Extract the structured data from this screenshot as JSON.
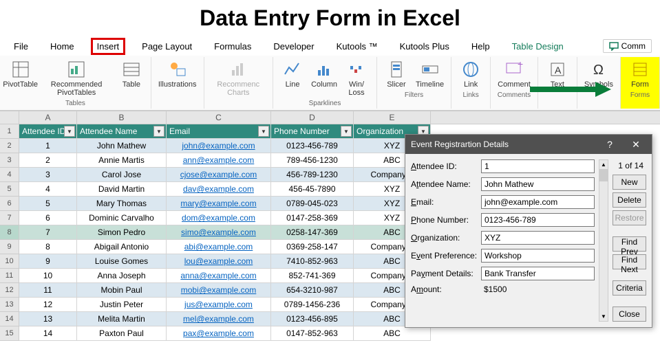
{
  "page_title": "Data Entry Form in Excel",
  "tabs": [
    "File",
    "Home",
    "Insert",
    "Page Layout",
    "Formulas",
    "Developer",
    "Kutools ™",
    "Kutools Plus",
    "Help",
    "Table Design"
  ],
  "highlighted_tab": "Insert",
  "comments_label": "Comm",
  "ribbon_groups": {
    "tables": {
      "label": "Tables",
      "items": [
        "PivotTable",
        "Recommended PivotTables",
        "Table"
      ]
    },
    "illustrations": {
      "label": "",
      "items": [
        "Illustrations"
      ]
    },
    "charts": {
      "label": "",
      "items": [
        "Recommenc Charts"
      ]
    },
    "sparklines": {
      "label": "Sparklines",
      "items": [
        "Line",
        "Column",
        "Win/ Loss"
      ]
    },
    "filters": {
      "label": "Filters",
      "items": [
        "Slicer",
        "Timeline"
      ]
    },
    "links": {
      "label": "Links",
      "items": [
        "Link"
      ]
    },
    "comments": {
      "label": "Comments",
      "items": [
        "Comment"
      ]
    },
    "text": {
      "label": "",
      "items": [
        "Text"
      ]
    },
    "symbols": {
      "label": "",
      "items": [
        "Symbols"
      ]
    },
    "forms": {
      "label": "Forms",
      "items": [
        "Form"
      ]
    }
  },
  "columns": [
    "A",
    "B",
    "C",
    "D",
    "E"
  ],
  "headers": [
    "Attendee ID",
    "Attendee Name",
    "Email",
    "Phone Number",
    "Organization"
  ],
  "selected_row": 8,
  "rows": [
    {
      "n": 1,
      "id": "1",
      "name": "John Mathew",
      "email": "john@example.com",
      "phone": "0123-456-789",
      "org": "XYZ"
    },
    {
      "n": 2,
      "id": "2",
      "name": "Annie Martis",
      "email": "ann@example.com",
      "phone": "789-456-1230",
      "org": "ABC"
    },
    {
      "n": 3,
      "id": "3",
      "name": "Carol Jose",
      "email": "cjose@example.com",
      "phone": "456-789-1230",
      "org": "Company Z"
    },
    {
      "n": 4,
      "id": "4",
      "name": "David Martin",
      "email": "dav@example.com",
      "phone": "456-45-7890",
      "org": "XYZ"
    },
    {
      "n": 5,
      "id": "5",
      "name": "Mary Thomas",
      "email": "mary@example.com",
      "phone": "0789-045-023",
      "org": "XYZ"
    },
    {
      "n": 6,
      "id": "6",
      "name": "Dominic Carvalho",
      "email": "dom@example.com",
      "phone": "0147-258-369",
      "org": "XYZ"
    },
    {
      "n": 7,
      "id": "7",
      "name": "Simon Pedro",
      "email": "simo@example.com",
      "phone": "0258-147-369",
      "org": "ABC"
    },
    {
      "n": 8,
      "id": "8",
      "name": "Abigail Antonio",
      "email": "abi@example.com",
      "phone": "0369-258-147",
      "org": "Company Z"
    },
    {
      "n": 9,
      "id": "9",
      "name": "Louise Gomes",
      "email": "lou@example.com",
      "phone": "7410-852-963",
      "org": "ABC"
    },
    {
      "n": 10,
      "id": "10",
      "name": "Anna Joseph",
      "email": "anna@example.com",
      "phone": "852-741-369",
      "org": "Company Z"
    },
    {
      "n": 11,
      "id": "11",
      "name": "Mobin Paul",
      "email": "mobi@example.com",
      "phone": "654-3210-987",
      "org": "ABC"
    },
    {
      "n": 12,
      "id": "12",
      "name": "Justin Peter",
      "email": "jus@example.com",
      "phone": "0789-1456-236",
      "org": "Company Z"
    },
    {
      "n": 13,
      "id": "13",
      "name": "Melita Martin",
      "email": "mel@example.com",
      "phone": "0123-456-895",
      "org": "ABC"
    },
    {
      "n": 14,
      "id": "14",
      "name": "Paxton Paul",
      "email": "pax@example.com",
      "phone": "0147-852-963",
      "org": "ABC"
    }
  ],
  "form": {
    "title": "Event Registrartion Details",
    "counter": "1 of 14",
    "fields": [
      {
        "label": "Attendee ID:",
        "accel": "A",
        "value": "1",
        "editable": true
      },
      {
        "label": "Attendee Name:",
        "accel": "t",
        "value": "John Mathew",
        "editable": true
      },
      {
        "label": "Email:",
        "accel": "E",
        "value": "john@example.com",
        "editable": true
      },
      {
        "label": "Phone Number:",
        "accel": "P",
        "value": "0123-456-789",
        "editable": true
      },
      {
        "label": "Organization:",
        "accel": "O",
        "value": "XYZ",
        "editable": true
      },
      {
        "label": "Event Preference:",
        "accel": "v",
        "value": "Workshop",
        "editable": true
      },
      {
        "label": "Payment Details:",
        "accel": "y",
        "value": "Bank Transfer",
        "editable": true
      },
      {
        "label": "Amount:",
        "accel": "m",
        "value": "$1500",
        "editable": false
      }
    ],
    "buttons": {
      "new": "New",
      "delete": "Delete",
      "restore": "Restore",
      "find_prev": "Find Prev",
      "find_next": "Find Next",
      "criteria": "Criteria",
      "close": "Close"
    }
  }
}
